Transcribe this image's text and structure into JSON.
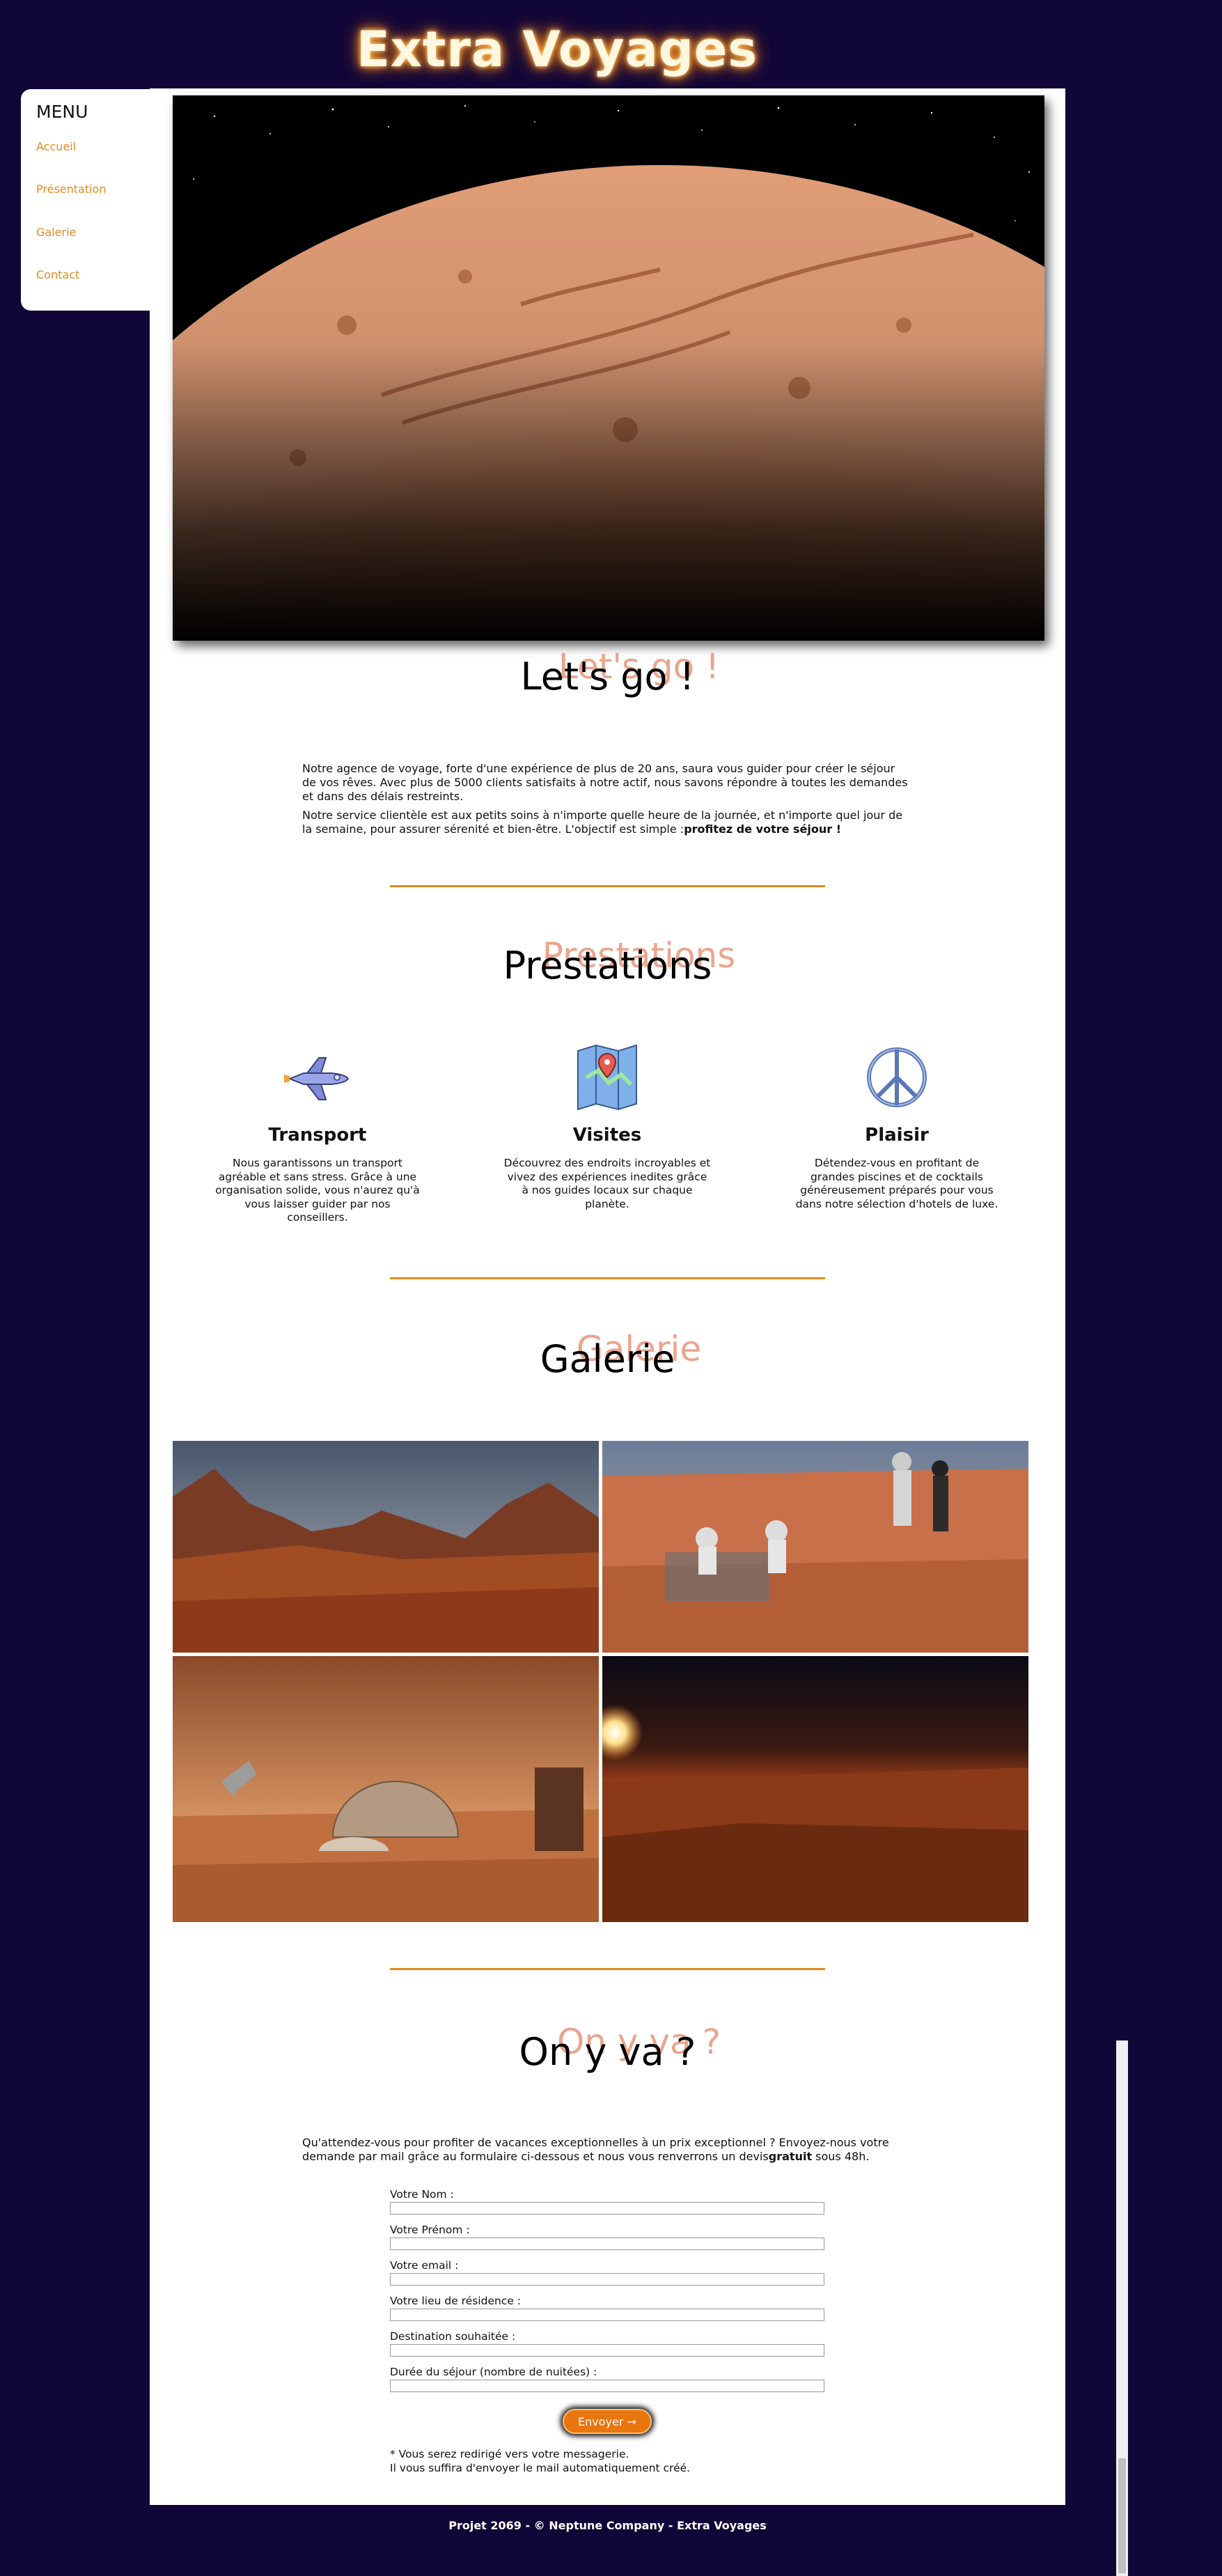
{
  "site": {
    "title": "Extra Voyages"
  },
  "menu": {
    "heading": "MENU",
    "items": [
      {
        "label": "Accueil"
      },
      {
        "label": "Présentation"
      },
      {
        "label": "Galerie"
      },
      {
        "label": "Contact"
      }
    ]
  },
  "hero": {
    "image": "mars-planet-photo"
  },
  "intro": {
    "title": "Let's go !",
    "paragraph1": "Notre agence de voyage, forte d'une expérience de plus de 20 ans, saura vous guider pour créer le séjour de vos rêves. Avec plus de 5000 clients satisfaits à notre actif, nous savons répondre à toutes les demandes et dans des délais restreints.",
    "paragraph2_prefix": "Notre service clientèle est aux petits soins à n'importe quelle heure de la journée, et n'importe quel jour de la semaine, pour assurer sérenité et bien-être. L'objectif est simple :",
    "paragraph2_bold": "profitez de votre séjour !"
  },
  "services": {
    "title": "Prestations",
    "items": [
      {
        "icon": "space-shuttle-icon",
        "title": "Transport",
        "text": "Nous garantissons un transport agréable et sans stress. Grâce à une organisation solide, vous n'aurez qu'à vous laisser guider par nos conseillers."
      },
      {
        "icon": "map-icon",
        "title": "Visites",
        "text": "Découvrez des endroits incroyables et vivez des expériences inedites grâce à nos guides locaux sur chaque planète."
      },
      {
        "icon": "peace-icon",
        "title": "Plaisir",
        "text": "Détendez-vous en profitant de grandes piscines et de cocktails généreusement préparés pour vous dans notre sélection d'hotels de luxe."
      }
    ]
  },
  "gallery": {
    "title": "Galerie",
    "images": [
      "mars-mountains",
      "astronauts-picnic",
      "mars-dome-base",
      "mars-sunrise"
    ]
  },
  "contact": {
    "title": "On y va ?",
    "intro_prefix": "Qu'attendez-vous pour profiter de vacances exceptionnelles à un prix exceptionnel ? Envoyez-nous votre demande par mail grâce au formulaire ci-dessous et nous vous renverrons un devis",
    "intro_bold": "gratuit",
    "intro_suffix": " sous 48h.",
    "fields": [
      {
        "label": "Votre Nom :",
        "value": ""
      },
      {
        "label": "Votre Prénom :",
        "value": ""
      },
      {
        "label": "Votre email :",
        "value": ""
      },
      {
        "label": "Votre lieu de résidence :",
        "value": ""
      },
      {
        "label": "Destination souhaitée :",
        "value": ""
      },
      {
        "label": "Durée du séjour (nombre de nuitées) :",
        "value": ""
      }
    ],
    "submit_label": "Envoyer →",
    "note1": "* Vous serez redirigé vers votre messagerie.",
    "note2": "Il vous suffira d'envoyer le mail automatiquement créé."
  },
  "footer": {
    "text": "Projet 2069 - © Neptune Company - Extra Voyages"
  },
  "colors": {
    "background": "#110638",
    "accent": "#e48a1c",
    "ghost_title": "#e8967a"
  }
}
